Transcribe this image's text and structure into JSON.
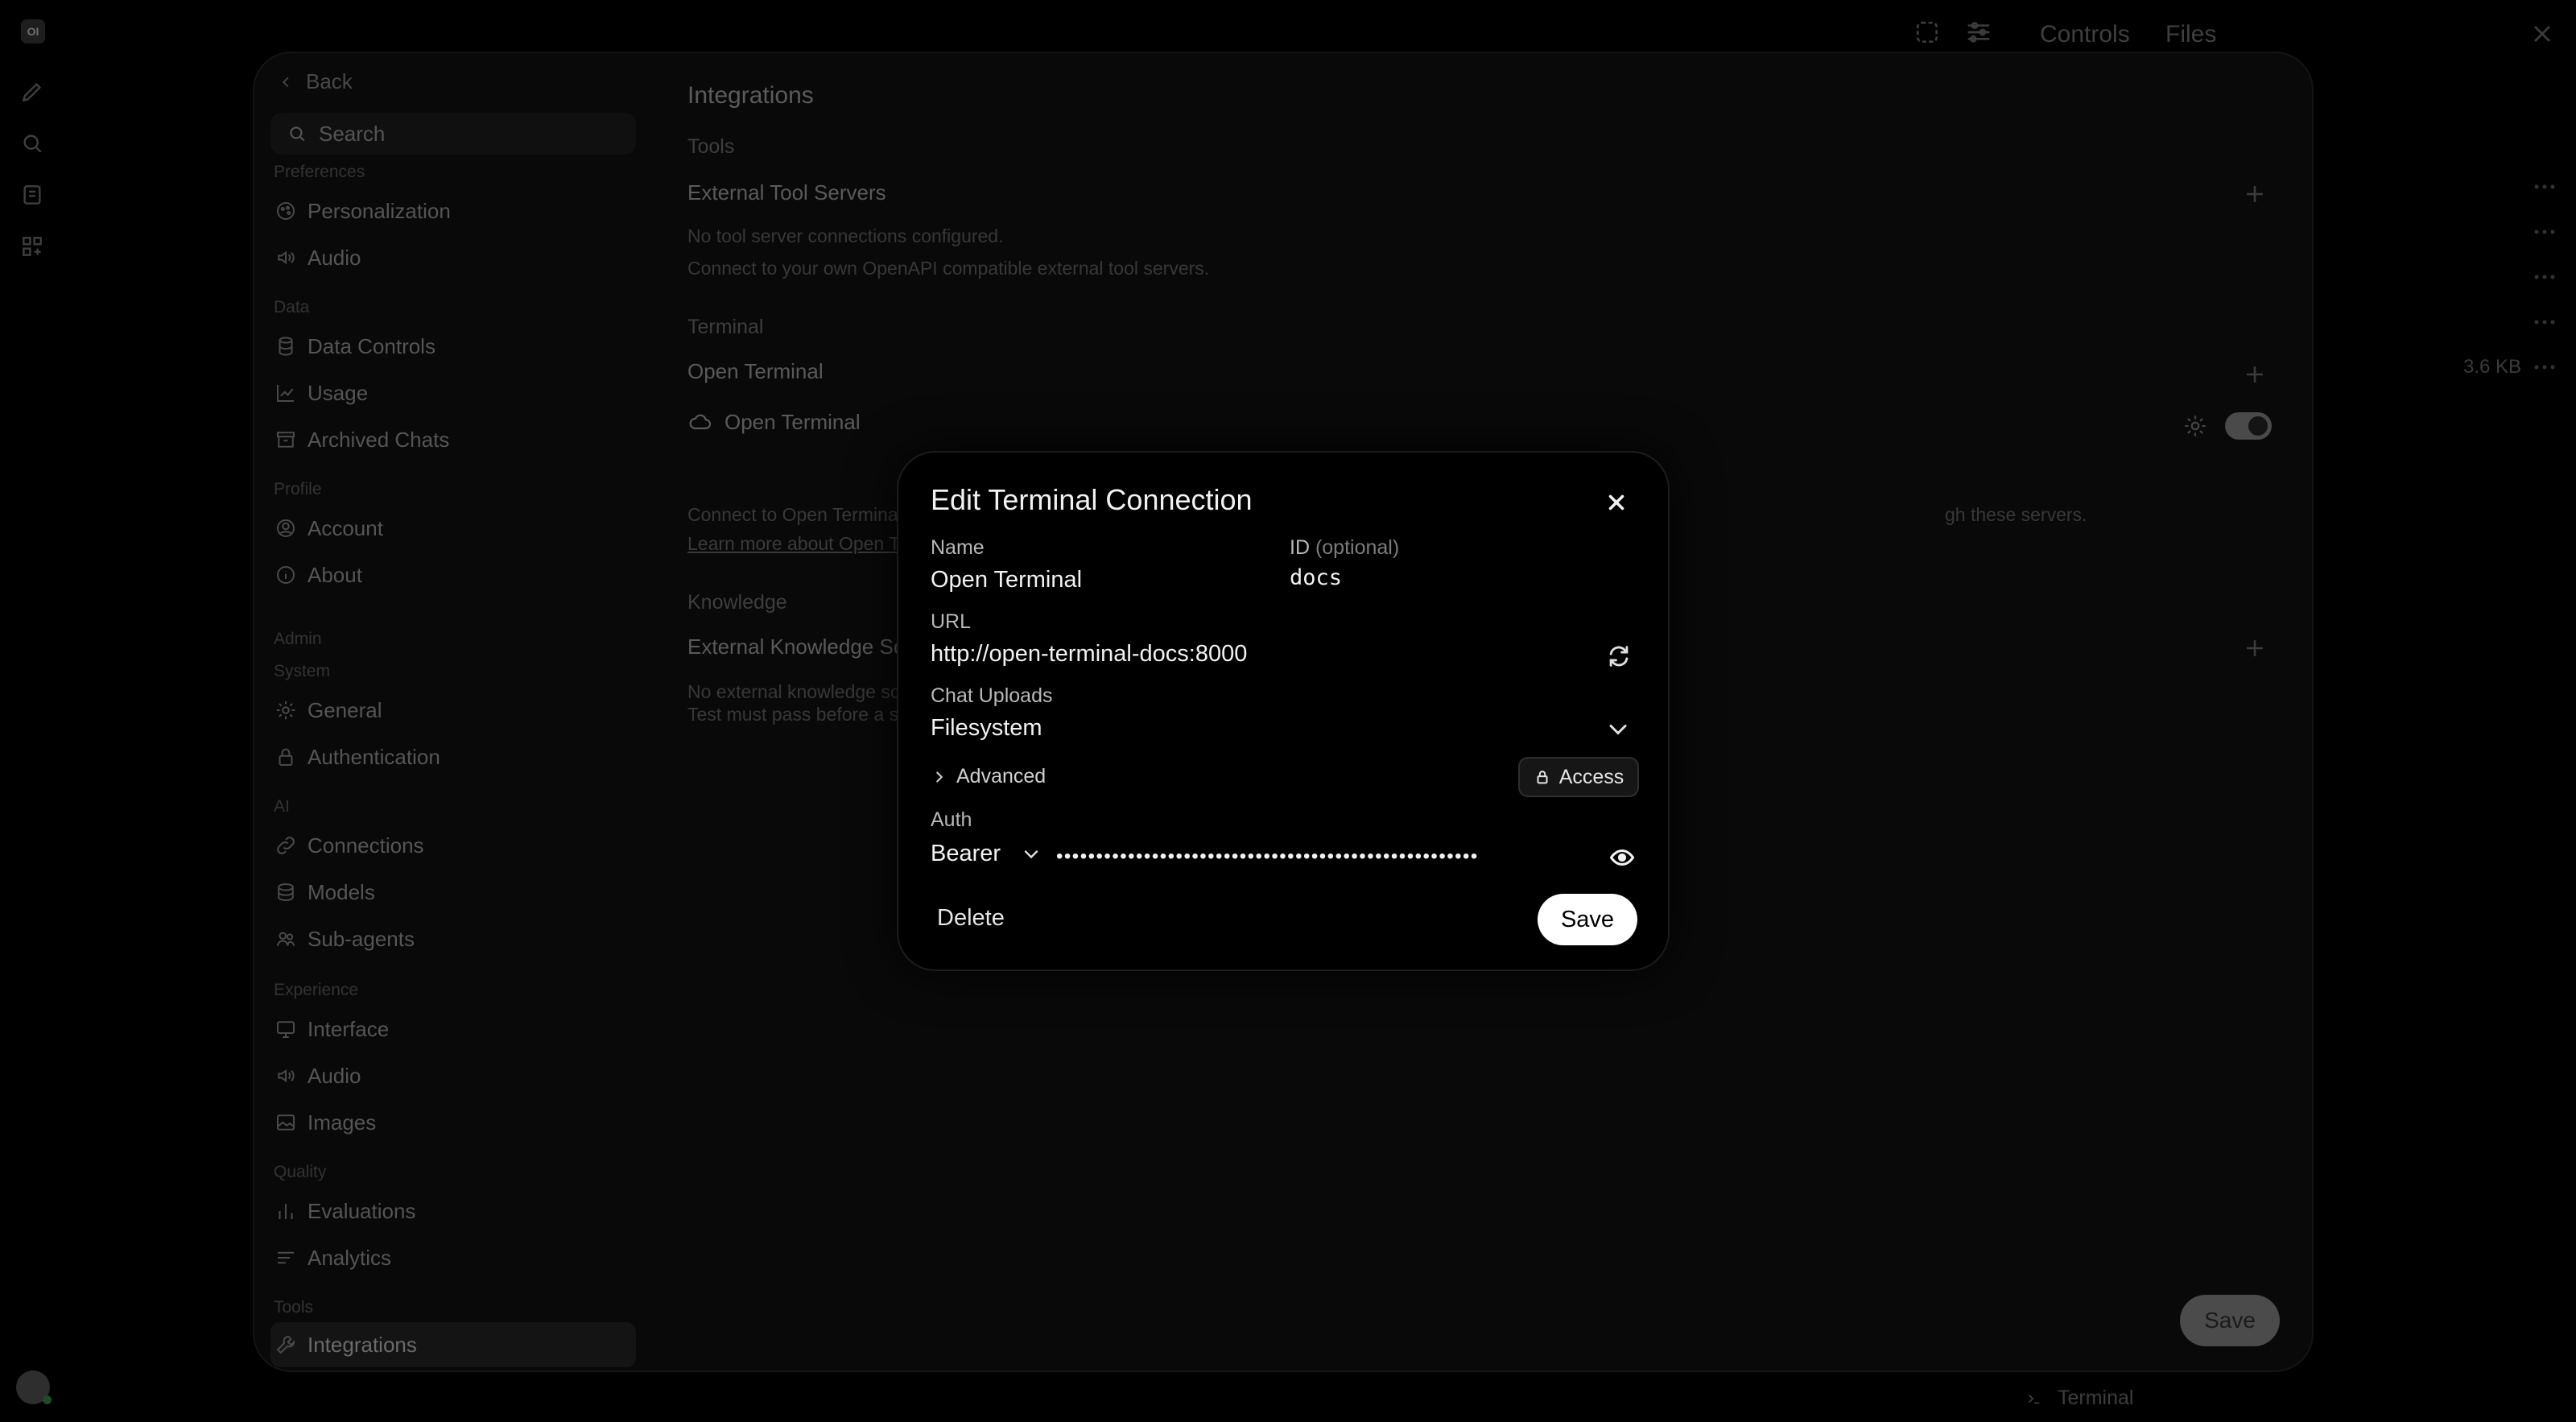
{
  "app": {
    "logo_text": "OI",
    "rail_icons": [
      "new-chat-icon",
      "search-icon",
      "notes-icon",
      "workspace-icon"
    ]
  },
  "topbar": {
    "controls_label": "Controls",
    "files_label": "Files",
    "file_size": "3.6 KB",
    "terminal_label": "Terminal"
  },
  "settings": {
    "back_label": "Back",
    "search_placeholder": "Search",
    "groups": {
      "preferences": "Preferences",
      "data": "Data",
      "profile": "Profile",
      "admin": "Admin",
      "system": "System",
      "ai": "AI",
      "experience": "Experience",
      "quality": "Quality",
      "tools": "Tools"
    },
    "items": {
      "personalization": "Personalization",
      "audio": "Audio",
      "data_controls": "Data Controls",
      "usage": "Usage",
      "archived_chats": "Archived Chats",
      "account": "Account",
      "about": "About",
      "general": "General",
      "authentication": "Authentication",
      "connections": "Connections",
      "models": "Models",
      "sub_agents": "Sub-agents",
      "interface": "Interface",
      "audio2": "Audio",
      "images": "Images",
      "evaluations": "Evaluations",
      "analytics": "Analytics",
      "integrations": "Integrations"
    },
    "main": {
      "title": "Integrations",
      "tools_section": "Tools",
      "external_tool_servers": "External Tool Servers",
      "no_tool_servers": "No tool server connections configured.",
      "connect_openapi": "Connect to your own OpenAPI compatible external tool servers.",
      "terminal_section": "Terminal",
      "open_terminal_row": "Open Terminal",
      "open_terminal_conn": "Open Terminal",
      "connect_open_terminal_a": "Connect to Open Terminal ins",
      "connect_open_terminal_b": "gh these servers.",
      "learn_more": "Learn more about Open Ter",
      "knowledge_section": "Knowledge",
      "external_knowledge": "External Knowledge Sou",
      "no_external_knowledge": "No external knowledge sou",
      "test_must_pass": "Test must pass before a so",
      "toggle_on": true,
      "save_label": "Save"
    }
  },
  "modal": {
    "title": "Edit Terminal Connection",
    "name_label": "Name",
    "name_value": "Open Terminal",
    "id_label": "ID",
    "id_optional": "(optional)",
    "id_value": "docs",
    "url_label": "URL",
    "url_value": "http://open-terminal-docs:8000",
    "chat_uploads_label": "Chat Uploads",
    "chat_uploads_value": "Filesystem",
    "advanced_label": "Advanced",
    "access_label": "Access",
    "auth_label": "Auth",
    "auth_type": "Bearer",
    "auth_key_masked": "•••••••••••••••••••••••••••••••••••••••••••••••••••••",
    "delete_label": "Delete",
    "save_label": "Save"
  }
}
